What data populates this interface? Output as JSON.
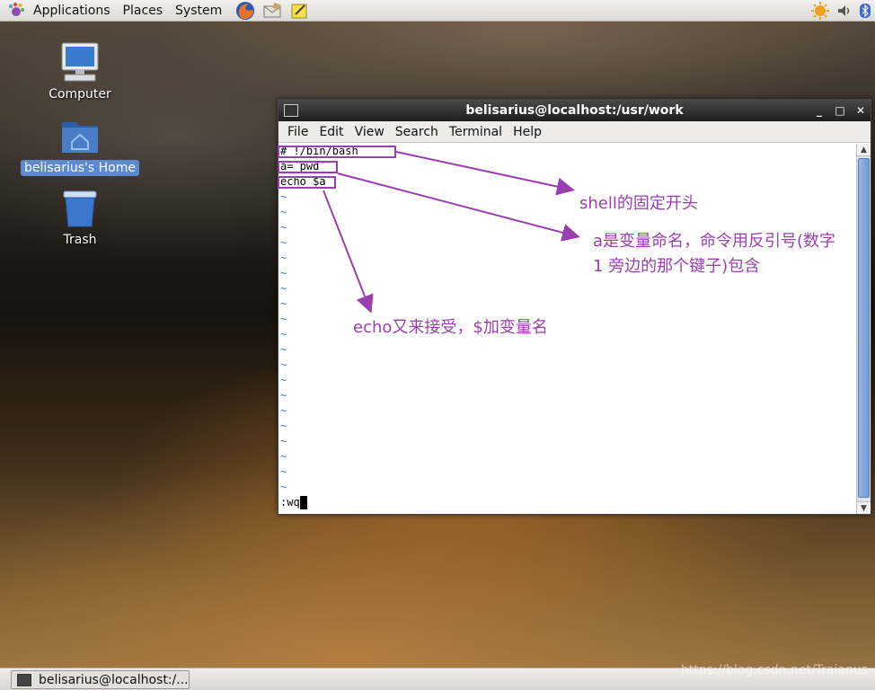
{
  "top_panel": {
    "menus": [
      "Applications",
      "Places",
      "System"
    ],
    "launchers": [
      "firefox-icon",
      "mail-icon",
      "notes-icon"
    ],
    "tray_icons": [
      "weather-sun-icon",
      "volume-icon",
      "bluetooth-icon"
    ]
  },
  "desktop": {
    "icons": [
      {
        "label": "Computer",
        "icon": "computer-icon"
      },
      {
        "label": "belisarius's Home",
        "icon": "home-folder-icon"
      },
      {
        "label": "Trash",
        "icon": "trash-icon"
      }
    ]
  },
  "window": {
    "title": "belisarius@localhost:/usr/work",
    "menus": [
      "File",
      "Edit",
      "View",
      "Search",
      "Terminal",
      "Help"
    ],
    "lines": [
      "# !/bin/bash",
      "a=`pwd`",
      "echo $a"
    ],
    "tilde": "~",
    "tilde_count": 20,
    "command": ":wq"
  },
  "annotations": {
    "shell_header": "shell的固定开头",
    "backtick_line1": "a是变量命名，命令用反引号(数字",
    "backtick_line2": "1 旁边的那个键子)包含",
    "echo_note": "echo又来接受，$加变量名",
    "color": "#9a3fb0"
  },
  "taskbar": {
    "task_label": "belisarius@localhost:/..."
  },
  "watermark": "https://blog.csdn.net/Traianus"
}
